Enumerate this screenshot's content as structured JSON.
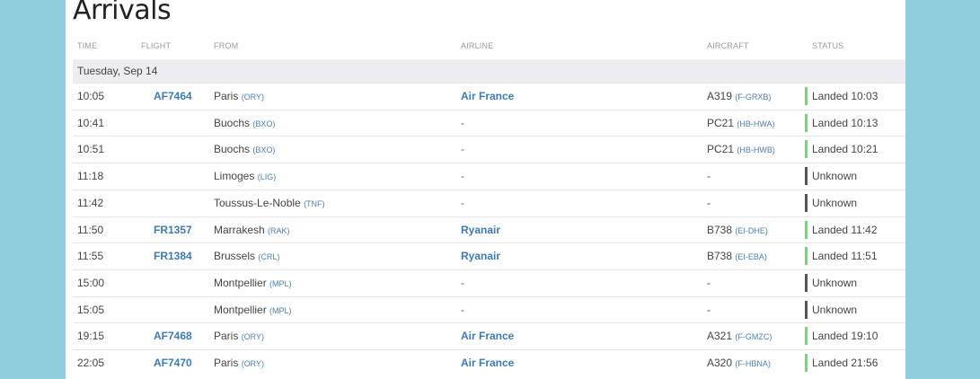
{
  "title": "Arrivals",
  "columns": {
    "time": "TIME",
    "flight": "FLIGHT",
    "from": "FROM",
    "airline": "AIRLINE",
    "aircraft": "AIRCRAFT",
    "status": "STATUS"
  },
  "day": "Tuesday, Sep 14",
  "colors": {
    "landed": "#7cd17c",
    "unknown": "#555555",
    "link": "#3f7ab3"
  },
  "rows": [
    {
      "time": "10:05",
      "flight": "AF7464",
      "from": "Paris",
      "from_code": "(ORY)",
      "airline": "Air France",
      "aircraft": "A319",
      "reg": "(F-GRXB)",
      "status": "Landed 10:03",
      "state": "landed"
    },
    {
      "time": "10:41",
      "flight": "",
      "from": "Buochs",
      "from_code": "(BXO)",
      "airline": "-",
      "aircraft": "PC21",
      "reg": "(HB-HWA)",
      "status": "Landed 10:13",
      "state": "landed"
    },
    {
      "time": "10:51",
      "flight": "",
      "from": "Buochs",
      "from_code": "(BXO)",
      "airline": "-",
      "aircraft": "PC21",
      "reg": "(HB-HWB)",
      "status": "Landed 10:21",
      "state": "landed"
    },
    {
      "time": "11:18",
      "flight": "",
      "from": "Limoges",
      "from_code": "(LIG)",
      "airline": "-",
      "aircraft": "-",
      "reg": "",
      "status": "Unknown",
      "state": "unknown"
    },
    {
      "time": "11:42",
      "flight": "",
      "from": "Toussus-Le-Noble",
      "from_code": "(TNF)",
      "airline": "-",
      "aircraft": "-",
      "reg": "",
      "status": "Unknown",
      "state": "unknown"
    },
    {
      "time": "11:50",
      "flight": "FR1357",
      "from": "Marrakesh",
      "from_code": "(RAK)",
      "airline": "Ryanair",
      "aircraft": "B738",
      "reg": "(EI-DHE)",
      "status": "Landed 11:42",
      "state": "landed"
    },
    {
      "time": "11:55",
      "flight": "FR1384",
      "from": "Brussels",
      "from_code": "(CRL)",
      "airline": "Ryanair",
      "aircraft": "B738",
      "reg": "(EI-EBA)",
      "status": "Landed 11:51",
      "state": "landed"
    },
    {
      "time": "15:00",
      "flight": "",
      "from": "Montpellier",
      "from_code": "(MPL)",
      "airline": "-",
      "aircraft": "-",
      "reg": "",
      "status": "Unknown",
      "state": "unknown"
    },
    {
      "time": "15:05",
      "flight": "",
      "from": "Montpellier",
      "from_code": "(MPL)",
      "airline": "-",
      "aircraft": "-",
      "reg": "",
      "status": "Unknown",
      "state": "unknown"
    },
    {
      "time": "19:15",
      "flight": "AF7468",
      "from": "Paris",
      "from_code": "(ORY)",
      "airline": "Air France",
      "aircraft": "A321",
      "reg": "(F-GMZC)",
      "status": "Landed 19:10",
      "state": "landed"
    },
    {
      "time": "22:05",
      "flight": "AF7470",
      "from": "Paris",
      "from_code": "(ORY)",
      "airline": "Air France",
      "aircraft": "A320",
      "reg": "(F-HBNA)",
      "status": "Landed 21:56",
      "state": "landed"
    }
  ]
}
